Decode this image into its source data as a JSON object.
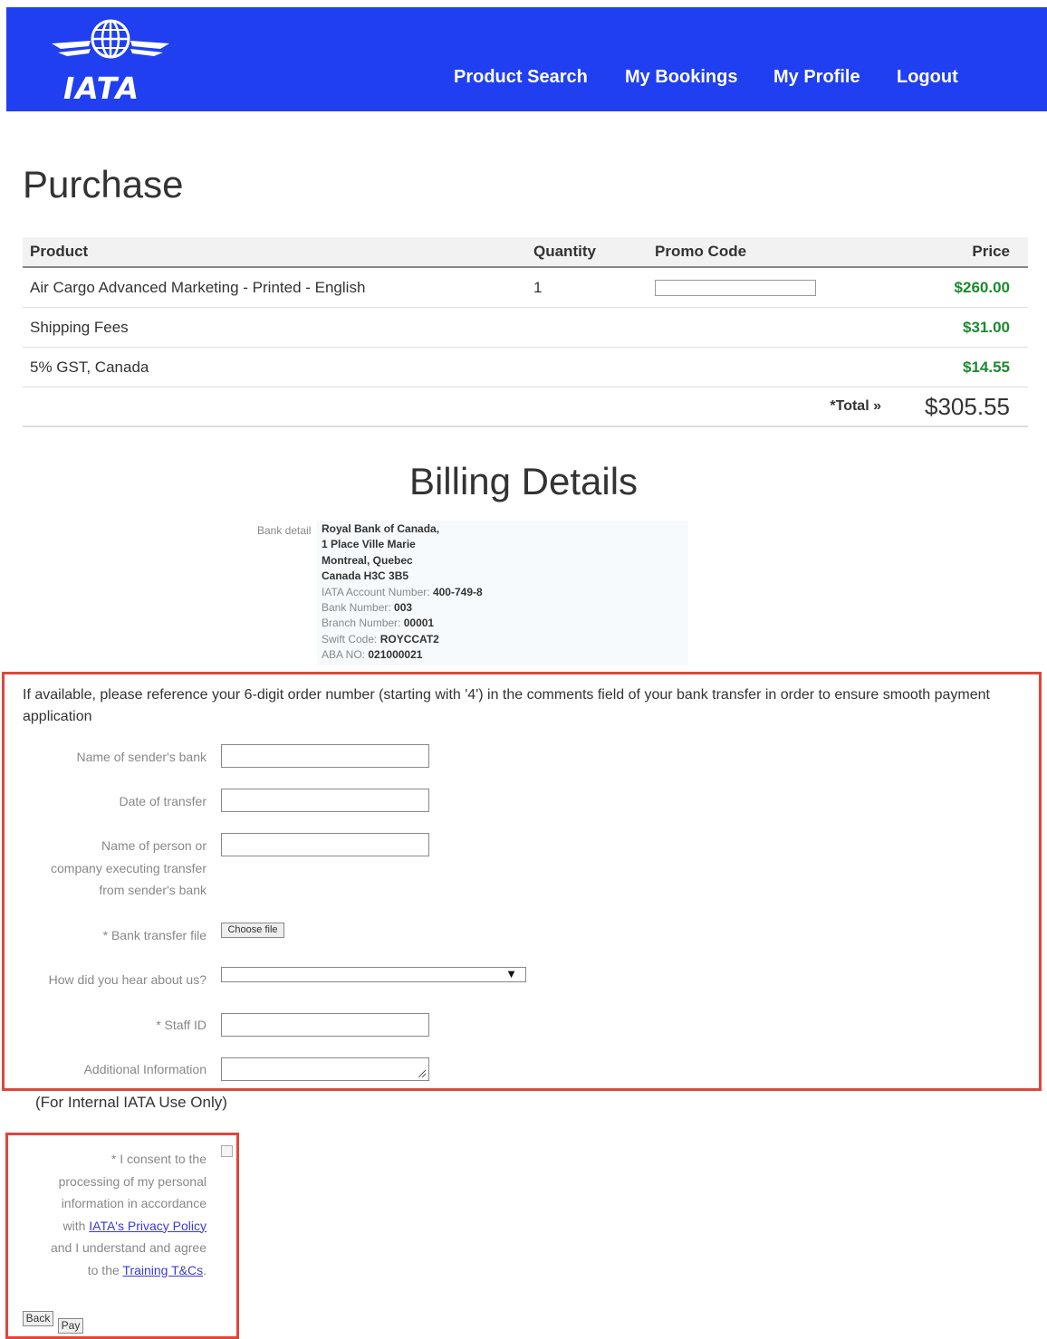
{
  "brand": {
    "logo_text": "IATA",
    "header_color": "#1f3ff0"
  },
  "nav": {
    "items": [
      {
        "label": "Product Search"
      },
      {
        "label": "My Bookings"
      },
      {
        "label": "My Profile"
      },
      {
        "label": "Logout"
      }
    ]
  },
  "page": {
    "title": "Purchase"
  },
  "table": {
    "headers": {
      "product": "Product",
      "quantity": "Quantity",
      "promo": "Promo Code",
      "price": "Price"
    },
    "rows": [
      {
        "product": "Air Cargo Advanced Marketing - Printed - English",
        "quantity": "1",
        "price": "$260.00"
      },
      {
        "product": "Shipping Fees",
        "quantity": "",
        "price": "$31.00"
      },
      {
        "product": "5% GST, Canada",
        "quantity": "",
        "price": "$14.55"
      }
    ],
    "total_label": "*Total »",
    "total_value": "$305.55",
    "price_color": "#1b8a2f"
  },
  "billing": {
    "title": "Billing Details",
    "bank_label": "Bank detail",
    "bank_lines": {
      "l1": "Royal Bank of Canada,",
      "l2": "1 Place Ville Marie",
      "l3": "Montreal, Quebec",
      "l4": "Canada H3C 3B5",
      "account_label": "IATA Account Number:",
      "account_value": "400-749-8",
      "bank_no_label": "Bank Number:",
      "bank_no_value": "003",
      "branch_label": "Branch Number:",
      "branch_value": "00001",
      "swift_label": "Swift Code:",
      "swift_value": "ROYCCAT2",
      "aba_label": "ABA NO:",
      "aba_value": "021000021"
    }
  },
  "form": {
    "intro": "If available, please reference your 6-digit order number (starting with '4') in the comments field of your bank transfer in order to ensure smooth payment application",
    "sender_bank_label": "Name of sender's bank",
    "date_label": "Date of transfer",
    "person_label_l1": "Name of person or",
    "person_label_l2": "company executing transfer",
    "person_label_l3": "from sender's bank",
    "file_label": "* Bank transfer file",
    "choose_file": "Choose file",
    "hear_label": "How did you hear about us?",
    "staff_label": "* Staff ID",
    "additional_label": "Additional Information",
    "internal_note": "(For Internal IATA Use Only)"
  },
  "consent": {
    "l1": "* I consent to the",
    "l2": "processing of my personal",
    "l3": "information in accordance",
    "l4_prefix": "with ",
    "privacy_link": "IATA's Privacy Policy",
    "l5": "and I understand and agree",
    "l6_prefix": "to the ",
    "tc_link": "Training T&Cs",
    "l6_suffix": "."
  },
  "buttons": {
    "back": "Back",
    "pay": "Pay"
  },
  "highlight_color": "#e0463a"
}
